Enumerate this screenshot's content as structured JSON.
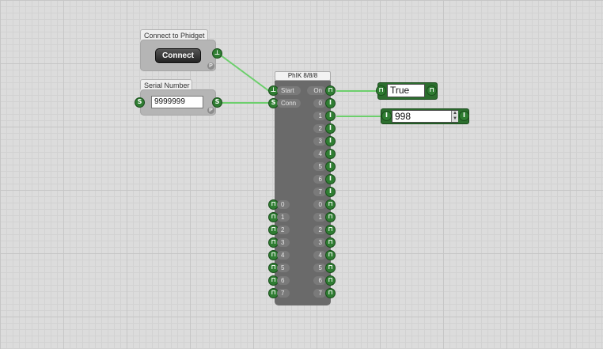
{
  "connect_widget": {
    "title": "Connect to Phidget",
    "button_label": "Connect",
    "badge": "P"
  },
  "serial_widget": {
    "title": "Serial Number",
    "value": "9999999",
    "badge": "P"
  },
  "phik_module": {
    "title": "PhIK 8/8/8",
    "start_label": "Start",
    "conn_label": "Conn",
    "on_label": "On",
    "sensor_labels": [
      "0",
      "1",
      "2",
      "3",
      "4",
      "5",
      "6",
      "7"
    ],
    "output_labels": [
      "0",
      "1",
      "2",
      "3",
      "4",
      "5",
      "6",
      "7"
    ],
    "input_labels": [
      "0",
      "1",
      "2",
      "3",
      "4",
      "5",
      "6",
      "7"
    ]
  },
  "on_output": {
    "value": "True"
  },
  "sensor1_output": {
    "value": "998"
  },
  "colors": {
    "port_green": "#2f7d32",
    "wire_green": "#6ccf6c",
    "module_body": "#6a6a6a"
  }
}
